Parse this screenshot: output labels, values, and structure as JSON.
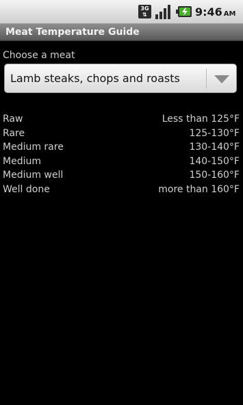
{
  "status_bar": {
    "network_type": "3G",
    "network_icon": "data-transfer-icon",
    "signal_icon": "signal-strength-icon",
    "battery_icon": "battery-charging-icon",
    "time": "9:46",
    "ampm": "AM"
  },
  "app": {
    "title": "Meat Temperature Guide"
  },
  "main": {
    "prompt": "Choose a meat",
    "selected_meat": "Lamb steaks, chops and roasts",
    "dropdown_icon": "dropdown-arrow-icon",
    "temperatures": [
      {
        "doneness": "Raw",
        "range": "Less than 125°F"
      },
      {
        "doneness": "Rare",
        "range": "125-130°F"
      },
      {
        "doneness": "Medium rare",
        "range": "130-140°F"
      },
      {
        "doneness": "Medium",
        "range": "140-150°F"
      },
      {
        "doneness": "Medium well",
        "range": "150-160°F"
      },
      {
        "doneness": "Well done",
        "range": "more than 160°F"
      }
    ]
  },
  "colors": {
    "background": "#000000",
    "status_bar": "#e0e0e0",
    "title_bar": "#707070",
    "text": "#d0d0d0",
    "battery_accent": "#4caf2f"
  }
}
